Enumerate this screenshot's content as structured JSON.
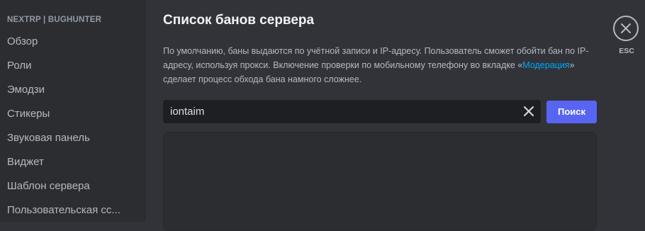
{
  "sidebar": {
    "header": "NEXTRP | BUGHUNTER",
    "items": [
      {
        "label": "Обзор"
      },
      {
        "label": "Роли"
      },
      {
        "label": "Эмодзи"
      },
      {
        "label": "Стикеры"
      },
      {
        "label": "Звуковая панель"
      },
      {
        "label": "Виджет"
      },
      {
        "label": "Шаблон сервера"
      },
      {
        "label": "Пользовательская сс..."
      }
    ]
  },
  "main": {
    "title": "Список банов сервера",
    "description": {
      "part1": "По умолчанию, баны выдаются по учётной записи и IP-адресу. Пользователь сможет обойти бан по IP-адресу, используя прокси. Включение проверки по мобильному телефону во вкладке «",
      "link": "Модерация",
      "part2": "» сделает процесс обхода бана намного сложнее."
    },
    "search": {
      "value": "iontaim",
      "button_label": "Поиск"
    }
  },
  "close": {
    "label": "ESC",
    "icon": "close-icon"
  },
  "colors": {
    "background": "#313338",
    "sidebar": "#2b2d31",
    "input": "#1e1f22",
    "accent": "#5865f2",
    "link": "#00a8fc"
  }
}
